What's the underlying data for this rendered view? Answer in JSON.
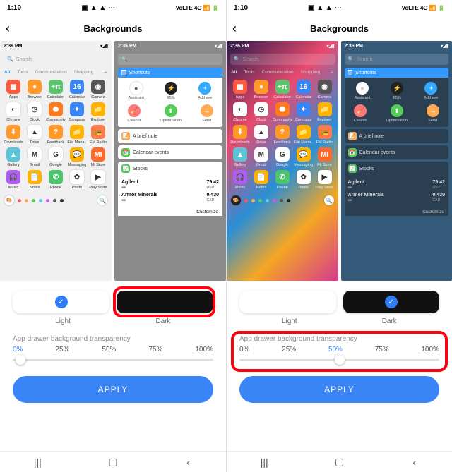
{
  "left": {
    "status": {
      "time": "1:10",
      "icons": "▣ ▲ ▲ ⋯",
      "right": "VoLTE 4G 📶 🔋"
    },
    "title": "Backgrounds",
    "preview_time": "2:36 PM",
    "search": "Search",
    "tabs": [
      "All",
      "Tools",
      "Communication",
      "Shopping"
    ],
    "apps": [
      {
        "n": "Apps",
        "c": "#ff5a3c",
        "g": "▦"
      },
      {
        "n": "Browser",
        "c": "#ff9a2a",
        "g": "●"
      },
      {
        "n": "Calculator",
        "c": "#5cc46e",
        "g": "+π"
      },
      {
        "n": "Calendar",
        "c": "#3a85f5",
        "g": "16"
      },
      {
        "n": "Camera",
        "c": "#555",
        "g": "◉"
      },
      {
        "n": "Chrome",
        "c": "#fff",
        "g": "◐"
      },
      {
        "n": "Clock",
        "c": "#fff",
        "g": "◷"
      },
      {
        "n": "Community",
        "c": "#ff7a1c",
        "g": "⬣"
      },
      {
        "n": "Compass",
        "c": "#3a85f5",
        "g": "✦"
      },
      {
        "n": "Explorer",
        "c": "#ffb300",
        "g": "📁"
      },
      {
        "n": "Downloads",
        "c": "#ff9a2a",
        "g": "⬇"
      },
      {
        "n": "Drive",
        "c": "#fff",
        "g": "▲"
      },
      {
        "n": "Feedback",
        "c": "#ff9a2a",
        "g": "?"
      },
      {
        "n": "File Mana..",
        "c": "#ffb300",
        "g": "📁"
      },
      {
        "n": "FM Radio",
        "c": "#ff7a4c",
        "g": "📻"
      },
      {
        "n": "Gallery",
        "c": "#5cc4d6",
        "g": "▲"
      },
      {
        "n": "Gmail",
        "c": "#fff",
        "g": "M"
      },
      {
        "n": "Google",
        "c": "#fff",
        "g": "G"
      },
      {
        "n": "Messaging",
        "c": "#ffb300",
        "g": "💬"
      },
      {
        "n": "Mi Store",
        "c": "#ff6a2a",
        "g": "MI"
      },
      {
        "n": "Music",
        "c": "#b05cf5",
        "g": "🎧"
      },
      {
        "n": "Notes",
        "c": "#ffb300",
        "g": "📄"
      },
      {
        "n": "Phone",
        "c": "#4cc46e",
        "g": "✆"
      },
      {
        "n": "Photo",
        "c": "#fff",
        "g": "✿"
      },
      {
        "n": "Play Store",
        "c": "#fff",
        "g": "▶"
      }
    ],
    "dot_colors": [
      "#f55",
      "#fa5",
      "#5c5",
      "#5cf",
      "#c5f",
      "#555",
      "#222"
    ],
    "widgets": {
      "shortcuts_label": "Shortcuts",
      "items": [
        {
          "n": "Assistant",
          "c": "#fff",
          "g": "●"
        },
        {
          "n": "65%",
          "c": "#222",
          "g": "⚡"
        },
        {
          "n": "Add eve",
          "c": "#3af",
          "g": "+"
        }
      ],
      "row2": [
        {
          "n": "Cleaner",
          "c": "#f77",
          "g": "🧹"
        },
        {
          "n": "Optimization",
          "c": "#5c5",
          "g": "⬆"
        },
        {
          "n": "Send",
          "c": "#fa5",
          "g": "→"
        }
      ],
      "brief": "A brief note",
      "cal": "Calendar events",
      "stocks_label": "Stocks",
      "stocks": [
        {
          "n": "Agilent",
          "v": "79.42",
          "s": "USD"
        },
        {
          "n": "Armor Minerals",
          "v": "0.430",
          "s": "CAD"
        }
      ],
      "customize": "Customize"
    },
    "sel": {
      "light": "Light",
      "dark": "Dark",
      "checked": "light"
    },
    "trans_label": "App drawer background transparency",
    "trans_vals": [
      "0%",
      "25%",
      "50%",
      "75%",
      "100%"
    ],
    "trans_cur_idx": 0,
    "apply": "APPLY"
  },
  "right": {
    "status": {
      "time": "1:10",
      "icons": "▣ ▲ ▲ ⋯",
      "right": "VoLTE 4G 📶 🔋"
    },
    "title": "Backgrounds",
    "sel": {
      "light": "Light",
      "dark": "Dark",
      "checked": "dark"
    },
    "trans_label": "App drawer background transparency",
    "trans_vals": [
      "0%",
      "25%",
      "50%",
      "75%",
      "100%"
    ],
    "trans_cur_idx": 2,
    "apply": "APPLY"
  }
}
